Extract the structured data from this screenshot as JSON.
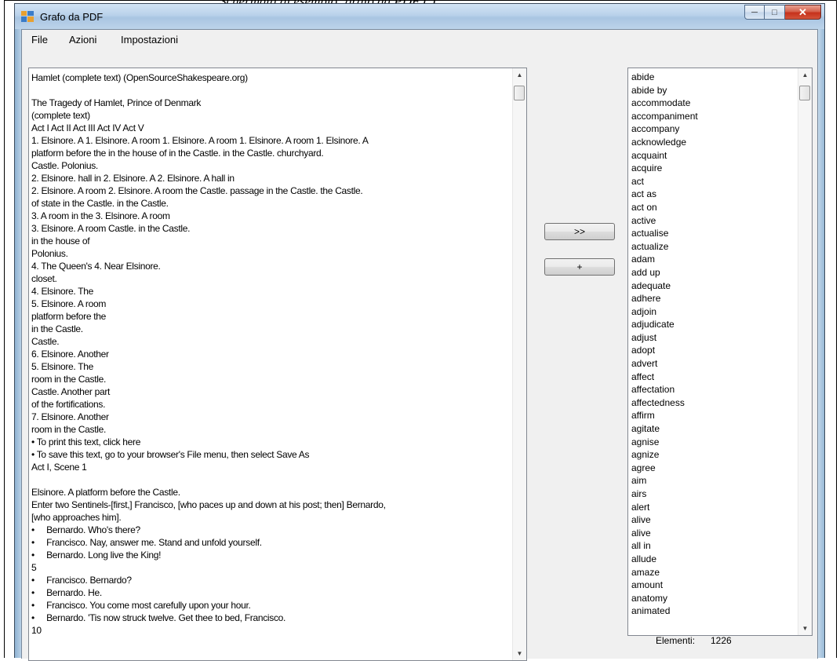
{
  "document_caption": "Schermata di esempio: grafo da PDF ( )",
  "window": {
    "title": "Grafo da PDF",
    "app_icon": "windows-form-icon",
    "caption_buttons": {
      "minimize": "─",
      "maximize": "□",
      "close": "✕"
    }
  },
  "menu": {
    "items": [
      "File",
      "Azioni",
      "Impostazioni"
    ]
  },
  "text_panel": {
    "content": "Hamlet (complete text) (OpenSourceShakespeare.org)\n\nThe Tragedy of Hamlet, Prince of Denmark\n(complete text)\nAct I Act II Act III Act IV Act V\n1. Elsinore. A 1. Elsinore. A room 1. Elsinore. A room 1. Elsinore. A room 1. Elsinore. A\nplatform before the in the house of in the Castle. in the Castle. churchyard.\nCastle. Polonius.\n2. Elsinore. hall in 2. Elsinore. A 2. Elsinore. A hall in\n2. Elsinore. A room 2. Elsinore. A room the Castle. passage in the Castle. the Castle.\nof state in the Castle. in the Castle.\n3. A room in the 3. Elsinore. A room\n3. Elsinore. A room Castle. in the Castle.\nin the house of\nPolonius.\n4. The Queen's 4. Near Elsinore.\ncloset.\n4. Elsinore. The\n5. Elsinore. A room\nplatform before the\nin the Castle.\nCastle.\n6. Elsinore. Another\n5. Elsinore. The\nroom in the Castle.\nCastle. Another part\nof the fortifications.\n7. Elsinore. Another\nroom in the Castle.\n• To print this text, click here\n• To save this text, go to your browser's File menu, then select Save As\nAct I, Scene 1\n\nElsinore. A platform before the Castle.\nEnter two Sentinels-[first,] Francisco, [who paces up and down at his post; then] Bernardo,\n[who approaches him].\n•     Bernardo. Who's there?\n•     Francisco. Nay, answer me. Stand and unfold yourself.\n•     Bernardo. Long live the King!\n5\n•     Francisco. Bernardo?\n•     Bernardo. He.\n•     Francisco. You come most carefully upon your hour.\n•     Bernardo. 'Tis now struck twelve. Get thee to bed, Francisco.\n10",
    "scroll_up": "▲",
    "scroll_down": "▼"
  },
  "buttons": {
    "transfer_label": ">>",
    "add_label": "+"
  },
  "word_list": {
    "items": [
      "abide",
      "abide by",
      "accommodate",
      "accompaniment",
      "accompany",
      "acknowledge",
      "acquaint",
      "acquire",
      "act",
      "act as",
      "act on",
      "active",
      "actualise",
      "actualize",
      "adam",
      "add up",
      "adequate",
      "adhere",
      "adjoin",
      "adjudicate",
      "adjust",
      "adopt",
      "advert",
      "affect",
      "affectation",
      "affectedness",
      "affirm",
      "agitate",
      "agnise",
      "agnize",
      "agree",
      "aim",
      "airs",
      "alert",
      "alive",
      "alive",
      "all in",
      "allude",
      "amaze",
      "amount",
      "anatomy",
      "animated"
    ],
    "scroll_up": "▲",
    "scroll_down": "▼"
  },
  "count": {
    "label": "Elementi:",
    "value": "1226"
  }
}
